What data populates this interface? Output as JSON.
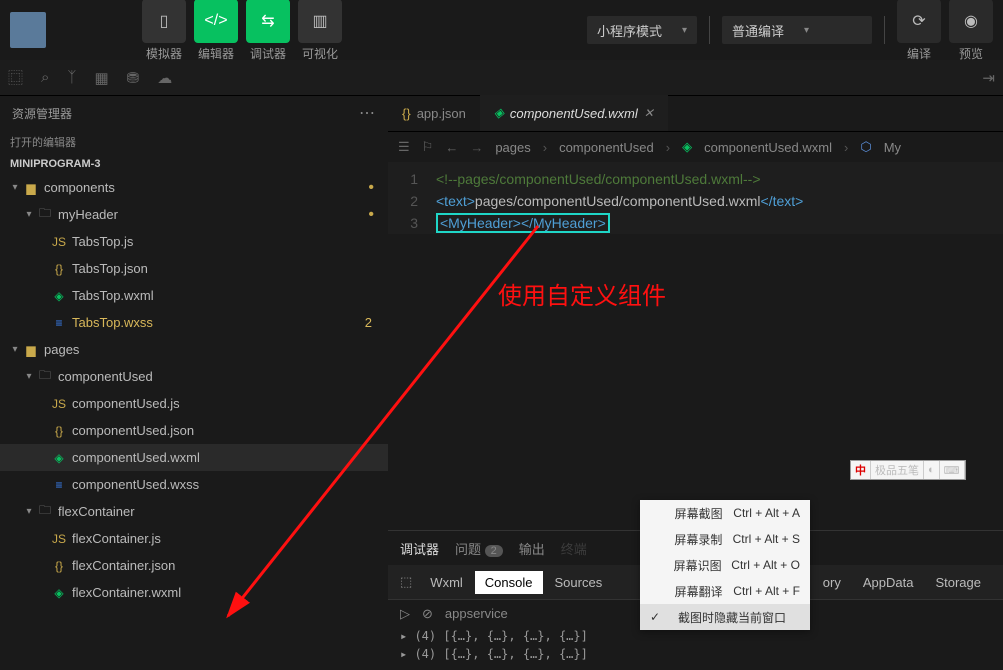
{
  "topbar": {
    "simulator": "模拟器",
    "editor": "编辑器",
    "debugger": "调试器",
    "visualize": "可视化",
    "mode": "小程序模式",
    "compile_mode": "普通编译",
    "compile": "编译",
    "preview": "预览"
  },
  "panel": {
    "explorer": "资源管理器",
    "open_editors": "打开的编辑器",
    "project": "MINIPROGRAM-3"
  },
  "tree": {
    "components": "components",
    "myHeader": "myHeader",
    "tabsTopJs": "TabsTop.js",
    "tabsTopJson": "TabsTop.json",
    "tabsTopWxml": "TabsTop.wxml",
    "tabsTopWxss": "TabsTop.wxss",
    "tabsTopWxssBadge": "2",
    "pages": "pages",
    "componentUsed": "componentUsed",
    "componentUsedJs": "componentUsed.js",
    "componentUsedJson": "componentUsed.json",
    "componentUsedWxml": "componentUsed.wxml",
    "componentUsedWxss": "componentUsed.wxss",
    "flexContainer": "flexContainer",
    "flexContainerJs": "flexContainer.js",
    "flexContainerJson": "flexContainer.json",
    "flexContainerWxml": "flexContainer.wxml"
  },
  "tabs": {
    "appJson": "app.json",
    "current": "componentUsed.wxml"
  },
  "crumbs": {
    "pages": "pages",
    "componentUsed": "componentUsed",
    "file": "componentUsed.wxml",
    "el": "My"
  },
  "code": {
    "l1": "<!--pages/componentUsed/componentUsed.wxml-->",
    "l2a": "<text>",
    "l2b": "pages/componentUsed/componentUsed.wxml",
    "l2c": "</text>",
    "l3a": "<MyHeader>",
    "l3b": "</MyHeader>"
  },
  "annotation": "使用自定义组件",
  "bottom": {
    "debugger": "调试器",
    "problems": "问题",
    "problems_count": "2",
    "output": "输出",
    "terminal": "终端",
    "wxml": "Wxml",
    "console": "Console",
    "sources": "Sources",
    "memory": "Memory",
    "appData": "AppData",
    "storage": "Storage",
    "appservice": "appservice",
    "log1": "▸ (4) [{…}, {…}, {…}, {…}]",
    "log2": "▸ (4) [{…}, {…}, {…}, {…}]"
  },
  "ctxmenu": {
    "i1": {
      "label": "屏幕截图",
      "sc": "Ctrl + Alt + A"
    },
    "i2": {
      "label": "屏幕录制",
      "sc": "Ctrl + Alt + S"
    },
    "i3": {
      "label": "屏幕识图",
      "sc": "Ctrl + Alt + O"
    },
    "i4": {
      "label": "屏幕翻译",
      "sc": "Ctrl + Alt + F"
    },
    "i5": {
      "label": "截图时隐藏当前窗口"
    }
  },
  "ime": "极品五笔"
}
